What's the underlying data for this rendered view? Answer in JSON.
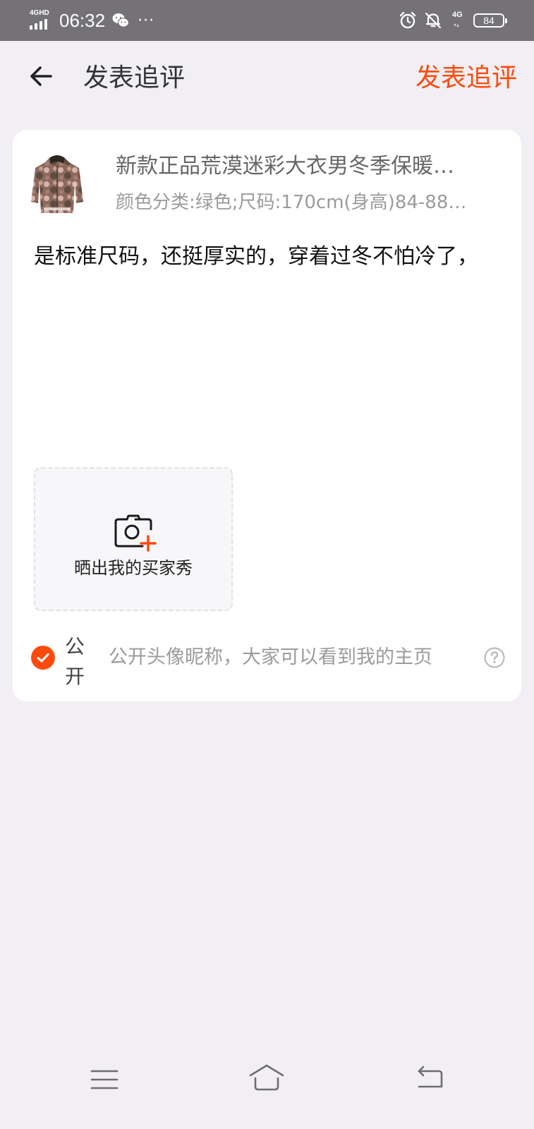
{
  "status_bar": {
    "network_label": "4GHD",
    "time": "06:32",
    "dots": "···",
    "mobile_label": "4G",
    "battery": "84"
  },
  "header": {
    "title": "发表追评",
    "publish_label": "发表追评"
  },
  "product": {
    "title": "新款正品荒漠迷彩大衣男冬季保暖…",
    "sku": "颜色分类:绿色;尺码:170cm(身高)84-88…"
  },
  "review": {
    "text": "是标准尺码，还挺厚实的，穿着过冬不怕冷了，"
  },
  "upload": {
    "label": "晒出我的买家秀"
  },
  "visibility": {
    "label": "公开",
    "description": "公开头像昵称，大家可以看到我的主页",
    "checked": true
  },
  "colors": {
    "accent": "#fe4a0d",
    "background": "#f1eff3",
    "status_bar": "#747276"
  },
  "icons": [
    "back-arrow-icon",
    "camera-plus-icon",
    "check-circle-icon",
    "help-icon",
    "menu-icon",
    "home-icon",
    "back-icon",
    "alarm-icon",
    "bell-off-icon",
    "wechat-icon",
    "battery-icon",
    "signal-icon"
  ]
}
